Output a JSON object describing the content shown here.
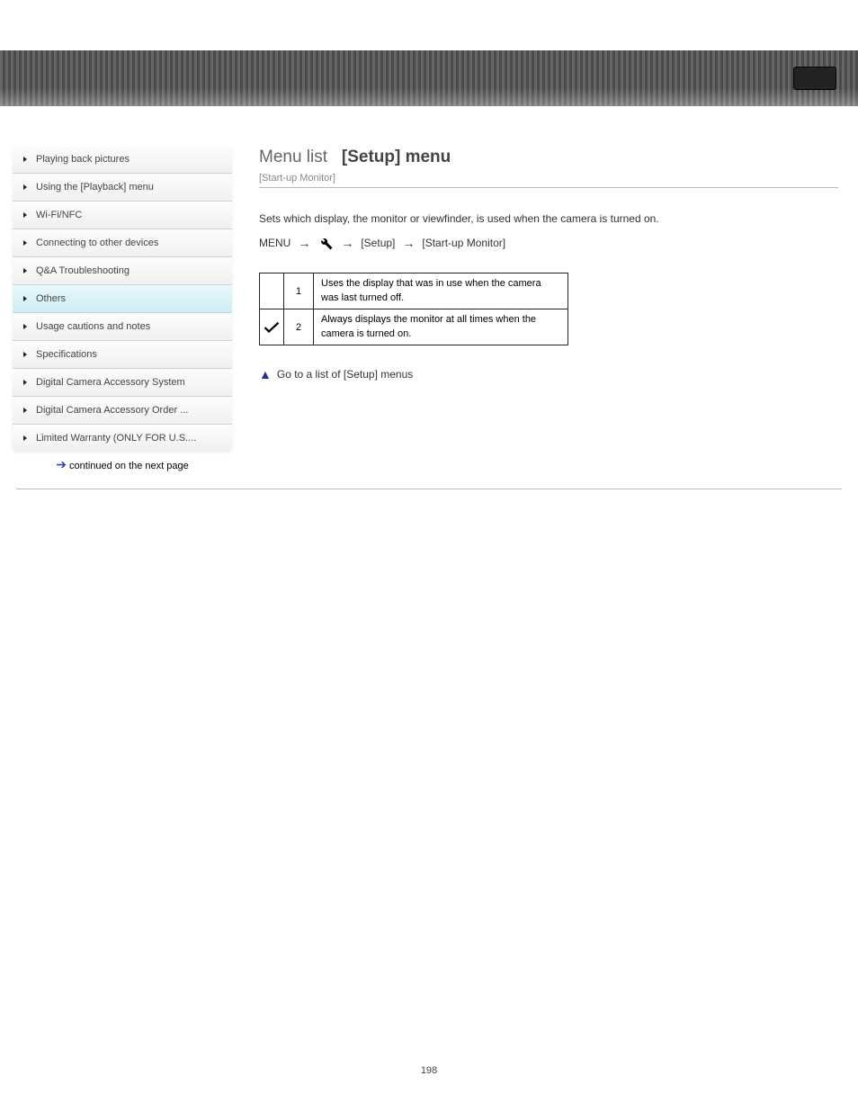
{
  "header": {},
  "sidebar": {
    "items": [
      {
        "label": "Playing back pictures"
      },
      {
        "label": "Using the [Playback] menu"
      },
      {
        "label": "Wi-Fi/NFC"
      },
      {
        "label": "Connecting to other devices"
      },
      {
        "label": "Q&A Troubleshooting"
      },
      {
        "label": "Others"
      },
      {
        "label": "Usage cautions and notes"
      },
      {
        "label": "Specifications"
      },
      {
        "label": "Digital Camera Accessory System"
      },
      {
        "label": "Digital Camera Accessory Order ..."
      },
      {
        "label": "Limited Warranty (ONLY FOR U.S...."
      }
    ],
    "active_index": 5,
    "continue_label": "continued on the next page"
  },
  "main": {
    "title_light": "Menu list",
    "title_bold": "[Setup] menu",
    "subtitle": "[Start-up Monitor]",
    "body_text": "Sets which display, the monitor or viewfinder, is used when the camera is turned on.",
    "path_menu": "MENU",
    "path_step1": "[Setup]",
    "path_step2": "[Start-up Monitor]",
    "table": {
      "rows": [
        {
          "check": false,
          "label": "1",
          "desc": "Uses the display that was in use when the camera was last turned off."
        },
        {
          "check": true,
          "label": "2",
          "desc": "Always displays the monitor at all times when the camera is turned on."
        }
      ]
    },
    "goto_label": "Go to a list of [Setup] menus"
  },
  "page_number": "198"
}
